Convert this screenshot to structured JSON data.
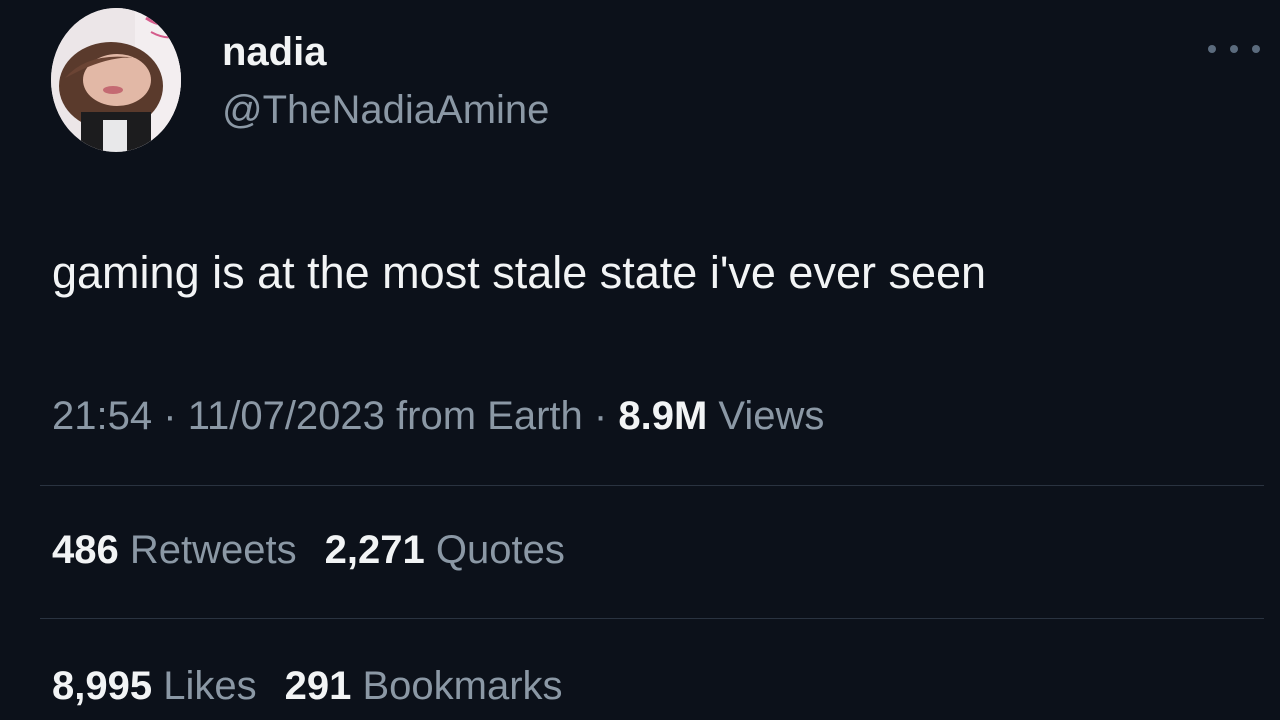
{
  "author": {
    "display_name": "nadia",
    "handle": "@TheNadiaAmine"
  },
  "tweet": {
    "text": "gaming is at the most stale state i've ever seen"
  },
  "meta": {
    "time": "21:54",
    "date": "11/07/2023",
    "source": "from Earth",
    "separator": "·",
    "views_count": "8.9M",
    "views_label": "Views"
  },
  "stats": {
    "retweets_count": "486",
    "retweets_label": "Retweets",
    "quotes_count": "2,271",
    "quotes_label": "Quotes",
    "likes_count": "8,995",
    "likes_label": "Likes",
    "bookmarks_count": "291",
    "bookmarks_label": "Bookmarks"
  },
  "colors": {
    "background": "#0c111a",
    "primary_text": "#f2f4f5",
    "secondary_text": "#8b98a5",
    "divider": "#2a3340"
  },
  "icons": {
    "more": "more-options-icon"
  }
}
